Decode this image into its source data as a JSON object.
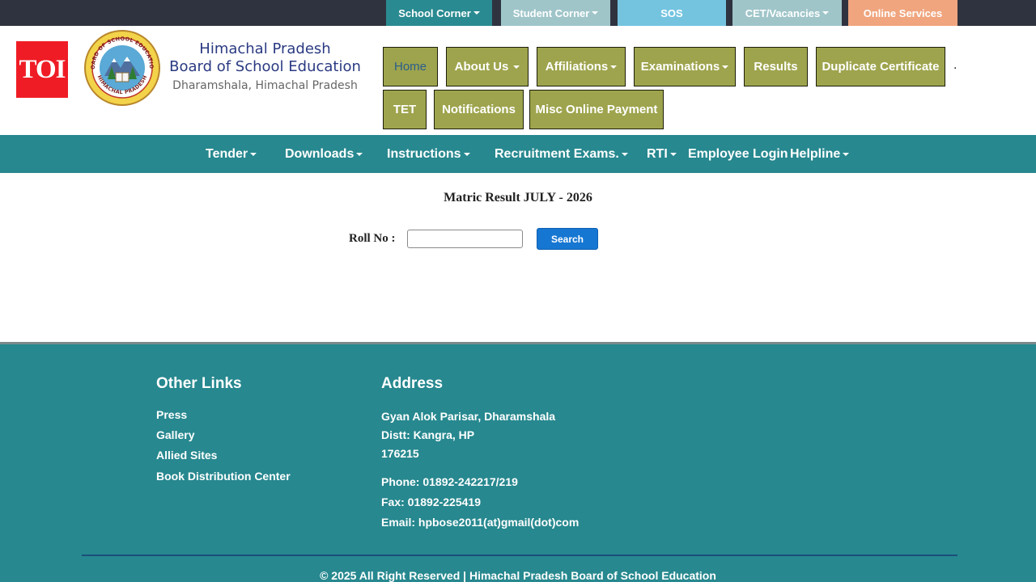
{
  "colors": {
    "top_strip": "#2f3340",
    "nav_olive": "#9ea44d",
    "teal": "#27888f",
    "search_blue": "#1677d2",
    "toi_red": "#ef1c25"
  },
  "top_links": [
    {
      "label": "School Corner",
      "dropdown": true,
      "color": "#2a8a91"
    },
    {
      "label": "Student Corner",
      "dropdown": true,
      "color": "#9fc5c9"
    },
    {
      "label": "SOS",
      "dropdown": false,
      "color": "#74c4e0"
    },
    {
      "label": "CET/Vacancies",
      "dropdown": true,
      "color": "#9fc5c9"
    },
    {
      "label": "Online Services",
      "dropdown": false,
      "color": "#f0a57e"
    }
  ],
  "header": {
    "toi_logo": "TOI",
    "seal_icon": "hpbose-seal-icon",
    "seal_text_top": "BOARD OF SCHOOL EDUCATION",
    "seal_text_bottom": "HIMACHAL PRADESH",
    "brand_line1": "Himachal Pradesh",
    "brand_line2": "Board of School Education",
    "brand_line3": "Dharamshala, Himachal Pradesh"
  },
  "nav_row1": [
    "Home",
    "About Us",
    "Affiliations",
    "Examinations",
    "Results",
    "Duplicate Certificate"
  ],
  "nav_row2": [
    "TET",
    "Notifications",
    "Misc Online Payment"
  ],
  "nav_dot": ".",
  "main_nav": [
    {
      "label": "Tender",
      "dropdown": true
    },
    {
      "label": "Downloads",
      "dropdown": true
    },
    {
      "label": "Instructions",
      "dropdown": true
    },
    {
      "label": "Recruitment Exams.",
      "dropdown": true
    },
    {
      "label": "RTI",
      "dropdown": true
    },
    {
      "label": "Employee Login",
      "dropdown": false
    },
    {
      "label": "Helpline",
      "dropdown": true
    }
  ],
  "result": {
    "title": "Matric Result JULY - 2026",
    "roll_label": "Roll No :",
    "roll_value": "",
    "search_label": "Search"
  },
  "footer": {
    "other_links_heading": "Other Links",
    "other_links": [
      "Press",
      "Gallery",
      "Allied Sites",
      "Book Distribution Center"
    ],
    "address_heading": "Address",
    "address_lines": [
      "Gyan Alok Parisar, Dharamshala",
      "Distt: Kangra, HP",
      "176215"
    ],
    "phone": "Phone: 01892-242217/219",
    "fax": "Fax: 01892-225419",
    "email": "Email: hpbose2011(at)gmail(dot)com",
    "copyright": "© 2025 All Right Reserved | Himachal Pradesh Board of School Education"
  }
}
